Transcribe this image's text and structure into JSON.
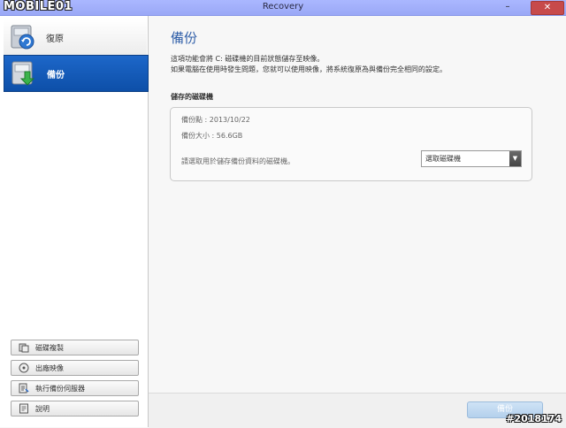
{
  "window": {
    "logo": "MOBILE01",
    "title": "Recovery",
    "minimize": "–",
    "maximize": "□",
    "close": "✕"
  },
  "sidebar": {
    "nav": [
      {
        "label": "復原",
        "icon": "restore-disk-icon"
      },
      {
        "label": "備份",
        "icon": "backup-disk-icon"
      }
    ],
    "actions": [
      {
        "label": "磁碟複製",
        "icon": "disk-copy-icon"
      },
      {
        "label": "出廠映像",
        "icon": "factory-image-icon"
      },
      {
        "label": "執行備份伺服器",
        "icon": "backup-server-icon"
      },
      {
        "label": "說明",
        "icon": "help-icon"
      }
    ]
  },
  "main": {
    "title": "備份",
    "description_line1": "這項功能會將 C: 磁碟機的目前狀態儲存至映像。",
    "description_line2": "如果電腦在使用時發生問題，您就可以使用映像，將系統復原為與備份完全相同的設定。",
    "section_title": "儲存的磁碟機",
    "backup_point": "備份點 : 2013/10/22",
    "backup_size": "備份大小 : 56.6GB",
    "select_prompt": "請選取用於儲存備份資料的磁碟機。",
    "select_value": "選取磁碟機",
    "backup_button": "備份"
  },
  "watermark": "#2018174",
  "colors": {
    "titlebar": "#9fadf8",
    "nav_active": "#1059b8",
    "page_title": "#2f5ea8",
    "close_button": "#c74a4a"
  }
}
